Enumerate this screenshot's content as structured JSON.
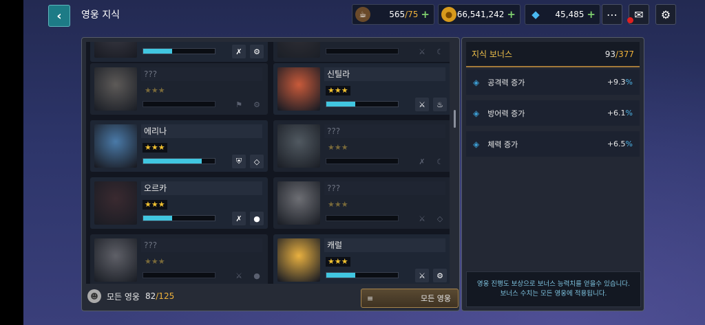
{
  "header": {
    "back_icon": "chevron-left-icon",
    "title": "영웅 지식",
    "stamina": {
      "icon": "coffee-icon",
      "value": "565",
      "max": "/75"
    },
    "gold": {
      "icon": "coin-icon",
      "value": "66,541,242"
    },
    "gems": {
      "icon": "diamond-icon",
      "value": "45,485"
    },
    "chat_icon": "chat-icon",
    "mail_icon": "mail-icon",
    "settings_icon": "gear-icon"
  },
  "heroes": [
    {
      "name": "",
      "locked": false,
      "stars": "",
      "progress": 0.4,
      "icons": [
        "sword-off-icon",
        "gear-icon"
      ],
      "portrait": "#3a3a44"
    },
    {
      "name": "",
      "locked": true,
      "stars": "",
      "progress": 0,
      "icons": [
        "sword-icon",
        "moon-icon"
      ],
      "portrait": "#5a3a3a"
    },
    {
      "name": "???",
      "locked": true,
      "stars": "★★★",
      "progress": 0,
      "icons": [
        "shield-wing-icon",
        "gear-icon"
      ],
      "portrait": "#c99a5a"
    },
    {
      "name": "신틸라",
      "locked": false,
      "stars": "★★★",
      "progress": 0.4,
      "icons": [
        "crossed-swords-icon",
        "fire-icon"
      ],
      "portrait": "#c85a3a"
    },
    {
      "name": "에리나",
      "locked": false,
      "stars": "★★★",
      "progress": 0.82,
      "icons": [
        "shield-icon",
        "diamond-outline-icon"
      ],
      "portrait": "#4a7aa8"
    },
    {
      "name": "???",
      "locked": true,
      "stars": "★★★",
      "progress": 0,
      "icons": [
        "sword-off-icon",
        "moon-icon"
      ],
      "portrait": "#7aa0a8"
    },
    {
      "name": "오르카",
      "locked": false,
      "stars": "★★★",
      "progress": 0.4,
      "icons": [
        "sword-off-icon",
        "water-drop-icon"
      ],
      "portrait": "#3a2a30"
    },
    {
      "name": "???",
      "locked": true,
      "stars": "★★★",
      "progress": 0,
      "icons": [
        "crossed-swords-icon",
        "diamond-outline-icon"
      ],
      "portrait": "#d8c8c0"
    },
    {
      "name": "???",
      "locked": true,
      "stars": "★★★",
      "progress": 0,
      "icons": [
        "crossed-swords-icon",
        "water-drop-icon"
      ],
      "portrait": "#b8a8b0"
    },
    {
      "name": "캐럴",
      "locked": false,
      "stars": "★★★",
      "progress": 0.4,
      "icons": [
        "crossed-swords-icon",
        "gear-icon"
      ],
      "portrait": "#e8b040"
    }
  ],
  "footer": {
    "icon": "hero-icon",
    "label": "모든 영웅",
    "count": "82",
    "total": "/125",
    "filter_icon": "menu-icon",
    "filter_label": "모든 영웅"
  },
  "bonus": {
    "label": "지식 보너스",
    "count": "93",
    "total": "/377",
    "stats": [
      {
        "label": "공격력 증가",
        "value": "+9.3",
        "unit": "%",
        "icon": "diamond-bullet-icon"
      },
      {
        "label": "방어력 증가",
        "value": "+6.1",
        "unit": "%",
        "icon": "diamond-bullet-icon"
      },
      {
        "label": "체력 증가",
        "value": "+6.5",
        "unit": "%",
        "icon": "diamond-bullet-icon"
      }
    ],
    "desc_line1": "영웅 진행도 보상으로 보너스 능력치를 얻을수 있습니다.",
    "desc_line2": "보너스 수치는 모든 영웅에 적용됩니다."
  }
}
